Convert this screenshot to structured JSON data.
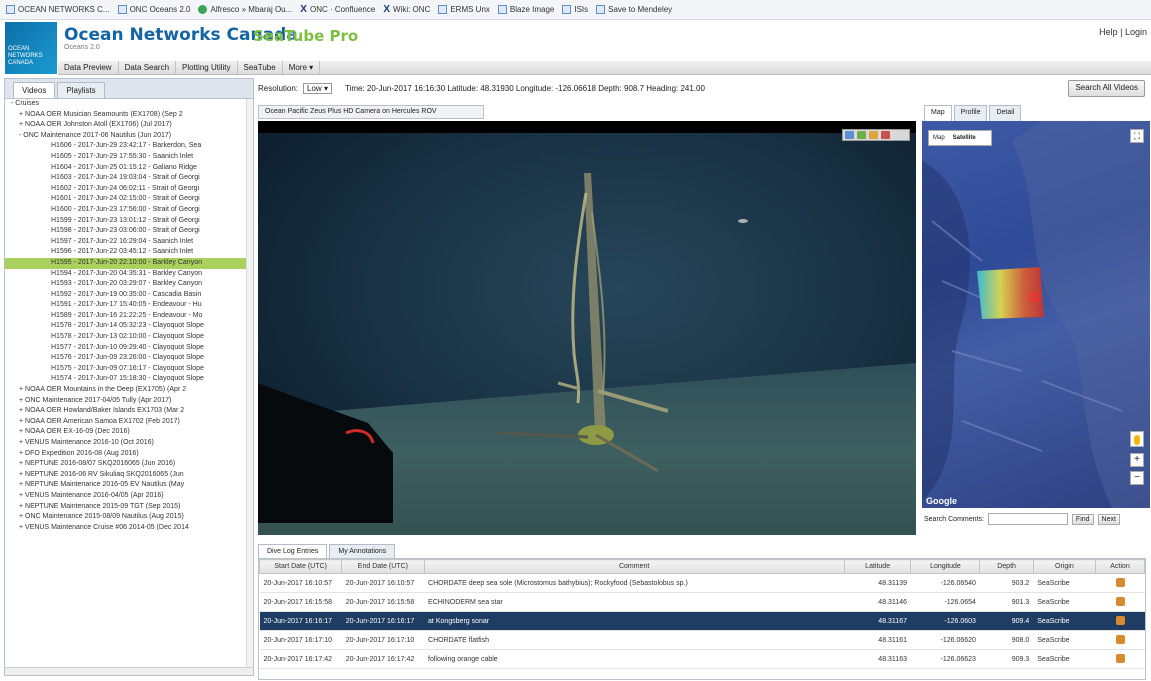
{
  "bookmarks": [
    {
      "icon": "page-icon",
      "label": "OCEAN NETWORKS C..."
    },
    {
      "icon": "page-icon",
      "label": "ONC Oceans 2.0"
    },
    {
      "icon": "globe-icon",
      "label": "Alfresco » Mbaraj Ou..."
    },
    {
      "icon": "x-icon",
      "label": "ONC · Confluence"
    },
    {
      "icon": "x-icon",
      "label": "Wiki: ONC"
    },
    {
      "icon": "page-icon",
      "label": "ERMS Unx"
    },
    {
      "icon": "page-icon",
      "label": "Blaze Image"
    },
    {
      "icon": "page-icon",
      "label": "ISIs"
    },
    {
      "icon": "page-icon",
      "label": "Save to Mendeley"
    }
  ],
  "header": {
    "org_title": "Ocean Networks Canada",
    "app_title": "SeaTube Pro",
    "version": "Oceans 2.0",
    "logo_text": "OCEAN NETWORKS CANADA",
    "user_link": "Help | Login"
  },
  "menu": [
    "Data Preview",
    "Data Search",
    "Plotting Utility",
    "SeaTube",
    "More"
  ],
  "left_tabs": [
    "Videos",
    "Playlists"
  ],
  "tree": [
    {
      "level": 0,
      "label": "- Cruises",
      "selected": false
    },
    {
      "level": 1,
      "label": "+ NOAA OER Musician Seamounts (EX1708) (Sep 2",
      "selected": false
    },
    {
      "level": 1,
      "label": "+ NOAA OER Johnston Atoll (EX1706) (Jul 2017)",
      "selected": false
    },
    {
      "level": 1,
      "label": "- ONC Maintenance 2017-06 Nautilus (Jun 2017)",
      "selected": false
    },
    {
      "level": 2,
      "label": "H1606 - 2017-Jun-29 23:42:17 - Barkerdon, Sea",
      "selected": false
    },
    {
      "level": 2,
      "label": "H1605 - 2017-Jun-29 17:55:30 - Saanich Inlet",
      "selected": false
    },
    {
      "level": 2,
      "label": "H1604 - 2017-Jun-25 01:15:12 - Galiano Ridge",
      "selected": false
    },
    {
      "level": 2,
      "label": "H1603 - 2017-Jun-24 19:03:04 - Strait of Georgi",
      "selected": false
    },
    {
      "level": 2,
      "label": "H1602 - 2017-Jun-24 06:02:11 - Strait of Georgi",
      "selected": false
    },
    {
      "level": 2,
      "label": "H1601 - 2017-Jun-24 02:15:00 - Strait of Georgi",
      "selected": false
    },
    {
      "level": 2,
      "label": "H1600 - 2017-Jun-23 17:56:00 - Strait of Georgi",
      "selected": false
    },
    {
      "level": 2,
      "label": "H1599 - 2017-Jun-23 13:01:12 - Strait of Georgi",
      "selected": false
    },
    {
      "level": 2,
      "label": "H1598 - 2017-Jun-23 03:06:00 - Strait of Georgi",
      "selected": false
    },
    {
      "level": 2,
      "label": "H1597 - 2017-Jun-22 16:29:04 - Saanich Inlet",
      "selected": false
    },
    {
      "level": 2,
      "label": "H1596 - 2017-Jun-22 03:45:12 - Saanich Inlet",
      "selected": false
    },
    {
      "level": 2,
      "label": "H1595 - 2017-Jun-20 22:10:00 - Barkley Canyon",
      "selected": true
    },
    {
      "level": 2,
      "label": "H1594 - 2017-Jun-20 04:35:31 - Barkley Canyon",
      "selected": false
    },
    {
      "level": 2,
      "label": "H1593 - 2017-Jun-20 03:29:07 - Barkley Canyon",
      "selected": false
    },
    {
      "level": 2,
      "label": "H1592 - 2017-Jun-19 00:35:00 - Cascadia Basin",
      "selected": false
    },
    {
      "level": 2,
      "label": "H1591 - 2017-Jun-17 15:40:05 - Endeavour - Hu",
      "selected": false
    },
    {
      "level": 2,
      "label": "H1589 - 2017-Jun-16 21:22:25 - Endeavour - Mo",
      "selected": false
    },
    {
      "level": 2,
      "label": "H1578 - 2017-Jun-14 05:32:23 - Clayoquot Slope",
      "selected": false
    },
    {
      "level": 2,
      "label": "H1578 - 2017-Jun-13 02:10:00 - Clayoquot Slope",
      "selected": false
    },
    {
      "level": 2,
      "label": "H1577 - 2017-Jun-10 09:29:40 - Clayoquot Slope",
      "selected": false
    },
    {
      "level": 2,
      "label": "H1576 - 2017-Jun-09 23:26:00 - Clayoquot Slope",
      "selected": false
    },
    {
      "level": 2,
      "label": "H1575 - 2017-Jun-09 07:16:17 - Clayoquot Slope",
      "selected": false
    },
    {
      "level": 2,
      "label": "H1574 - 2017-Jun-07 15:18:30 - Clayoquot Slope",
      "selected": false
    },
    {
      "level": 1,
      "label": "+ NOAA OER Mountains in the Deep (EX1705) (Apr 2",
      "selected": false
    },
    {
      "level": 1,
      "label": "+ ONC Maintenance 2017-04/05 Tully (Apr 2017)",
      "selected": false
    },
    {
      "level": 1,
      "label": "+ NOAA OER Howland/Baker Islands EX1703 (Mar 2",
      "selected": false
    },
    {
      "level": 1,
      "label": "+ NOAA OER American Samoa EX1702 (Feb 2017)",
      "selected": false
    },
    {
      "level": 1,
      "label": "+ NOAA OER EX-16-09 (Dec 2016)",
      "selected": false
    },
    {
      "level": 1,
      "label": "+ VENUS Maintenance 2016-10 (Oct 2016)",
      "selected": false
    },
    {
      "level": 1,
      "label": "+ DFO Expedition 2016-08 (Aug 2016)",
      "selected": false
    },
    {
      "level": 1,
      "label": "+ NEPTUNE 2016-08/07 SKQ2016065 (Jun 2016)",
      "selected": false
    },
    {
      "level": 1,
      "label": "+ NEPTUNE 2016-06 RV Sikuliaq SKQ2016065 (Jun",
      "selected": false
    },
    {
      "level": 1,
      "label": "+ NEPTUNE Maintenance 2016-05 EV Nautilus (May",
      "selected": false
    },
    {
      "level": 1,
      "label": "+ VENUS Maintenance 2016-04/05 (Apr 2016)",
      "selected": false
    },
    {
      "level": 1,
      "label": "+ NEPTUNE Maintenance 2015-09 TGT (Sep 2015)",
      "selected": false
    },
    {
      "level": 1,
      "label": "+ ONC Maintenance 2015-08/09 Nautilus (Aug 2015)",
      "selected": false
    },
    {
      "level": 1,
      "label": "+ VENUS Maintenance Cruise #06 2014-05 (Dec 2014",
      "selected": false
    }
  ],
  "toolbar": {
    "resolution_label": "Resolution:",
    "resolution_value": "Low",
    "time_info": "Time: 20-Jun-2017 16:16:30   Latitude: 48.31930   Longitude: -126.06618   Depth: 908.7   Heading: 241.00",
    "search_all_label": "Search All Videos"
  },
  "video": {
    "tab_label": "Ocean Pacific Zeus Plus HD Camera on Hercules ROV"
  },
  "map": {
    "tabs": [
      "Map",
      "Profile",
      "Detail"
    ],
    "type_options": [
      "Map",
      "Satellite"
    ],
    "attribution": "Google",
    "zoom_in": "+",
    "zoom_out": "−",
    "search_label": "Search Comments:",
    "search_value": "",
    "find_label": "Find",
    "next_label": "Next"
  },
  "bottom_tabs": [
    "Dive Log Entries",
    "My Annotations"
  ],
  "log_table": {
    "columns": [
      "Start Date (UTC)",
      "End Date (UTC)",
      "Comment",
      "Latitude",
      "Longitude",
      "Depth",
      "Origin",
      "Action"
    ],
    "rows": [
      {
        "start": "20-Jun-2017 16:10:57",
        "end": "20-Jun-2017 16:10:57",
        "comment": "CHORDATE deep sea sole (Microstomus bathybius); Rockyfood (Sebastolobus sp.)",
        "lat": "48.31139",
        "lon": "-126.06540",
        "depth": "903.2",
        "origin": "SeaScribe",
        "selected": false
      },
      {
        "start": "20-Jun-2017 16:15:58",
        "end": "20-Jun-2017 16:15:58",
        "comment": "ECHINODERM sea star",
        "lat": "48.31146",
        "lon": "-126.0654",
        "depth": "901.3",
        "origin": "SeaScribe",
        "selected": false
      },
      {
        "start": "20-Jun-2017 16:16:17",
        "end": "20-Jun-2017 16:16:17",
        "comment": "at Kongsberg sonar",
        "lat": "48.31167",
        "lon": "-126.0603",
        "depth": "909.4",
        "origin": "SeaScribe",
        "selected": true
      },
      {
        "start": "20-Jun-2017 16:17:10",
        "end": "20-Jun-2017 16:17:10",
        "comment": "CHORDATE flatfish",
        "lat": "48.31161",
        "lon": "-126.06620",
        "depth": "908.0",
        "origin": "SeaScribe",
        "selected": false
      },
      {
        "start": "20-Jun-2017 16:17:42",
        "end": "20-Jun-2017 16:17:42",
        "comment": "following orange cable",
        "lat": "48.31163",
        "lon": "-126.06623",
        "depth": "909.3",
        "origin": "SeaScribe",
        "selected": false
      }
    ]
  },
  "colors": {
    "brand_blue": "#1465a6",
    "brand_green": "#7fbf3f",
    "tree_selected": "#a8d15d",
    "row_selected": "#1f3d63"
  }
}
